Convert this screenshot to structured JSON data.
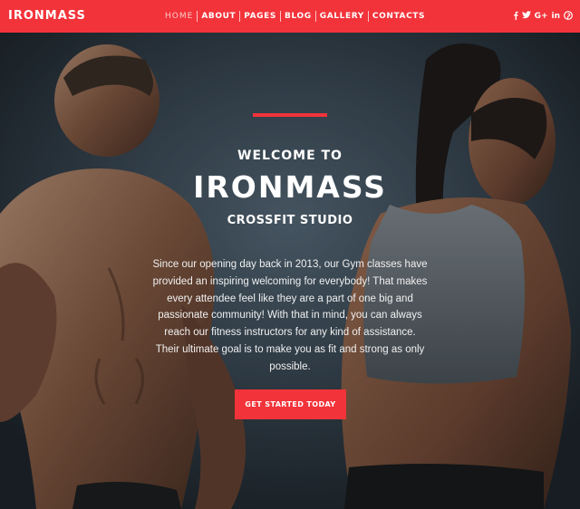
{
  "header": {
    "logo": "IRONMASS",
    "nav": [
      "HOME",
      "ABOUT",
      "PAGES",
      "BLOG",
      "GALLERY",
      "CONTACTS"
    ],
    "social": [
      {
        "icon": "facebook-icon",
        "glyph": "f"
      },
      {
        "icon": "twitter-icon",
        "glyph": "ᵭ7"
      },
      {
        "icon": "google-plus-icon",
        "glyph": "G+"
      },
      {
        "icon": "linkedin-icon",
        "glyph": "in"
      },
      {
        "icon": "pinterest-icon",
        "glyph": "℗"
      }
    ]
  },
  "hero": {
    "welcome": "WELCOME TO",
    "brand": "IRONMASS",
    "subtitle": "CROSSFIT STUDIO",
    "intro": "Since our opening day back in 2013, our Gym classes have provided an inspiring welcoming for everybody! That makes every attendee feel like they are a part of one big and passionate community! With that in mind, you can always reach our fitness instructors for any kind of assistance. Their ultimate goal is to make you as fit and strong as only possible.",
    "cta": "GET STARTED TODAY"
  },
  "colors": {
    "accent": "#f2333a",
    "text": "#ffffff"
  }
}
